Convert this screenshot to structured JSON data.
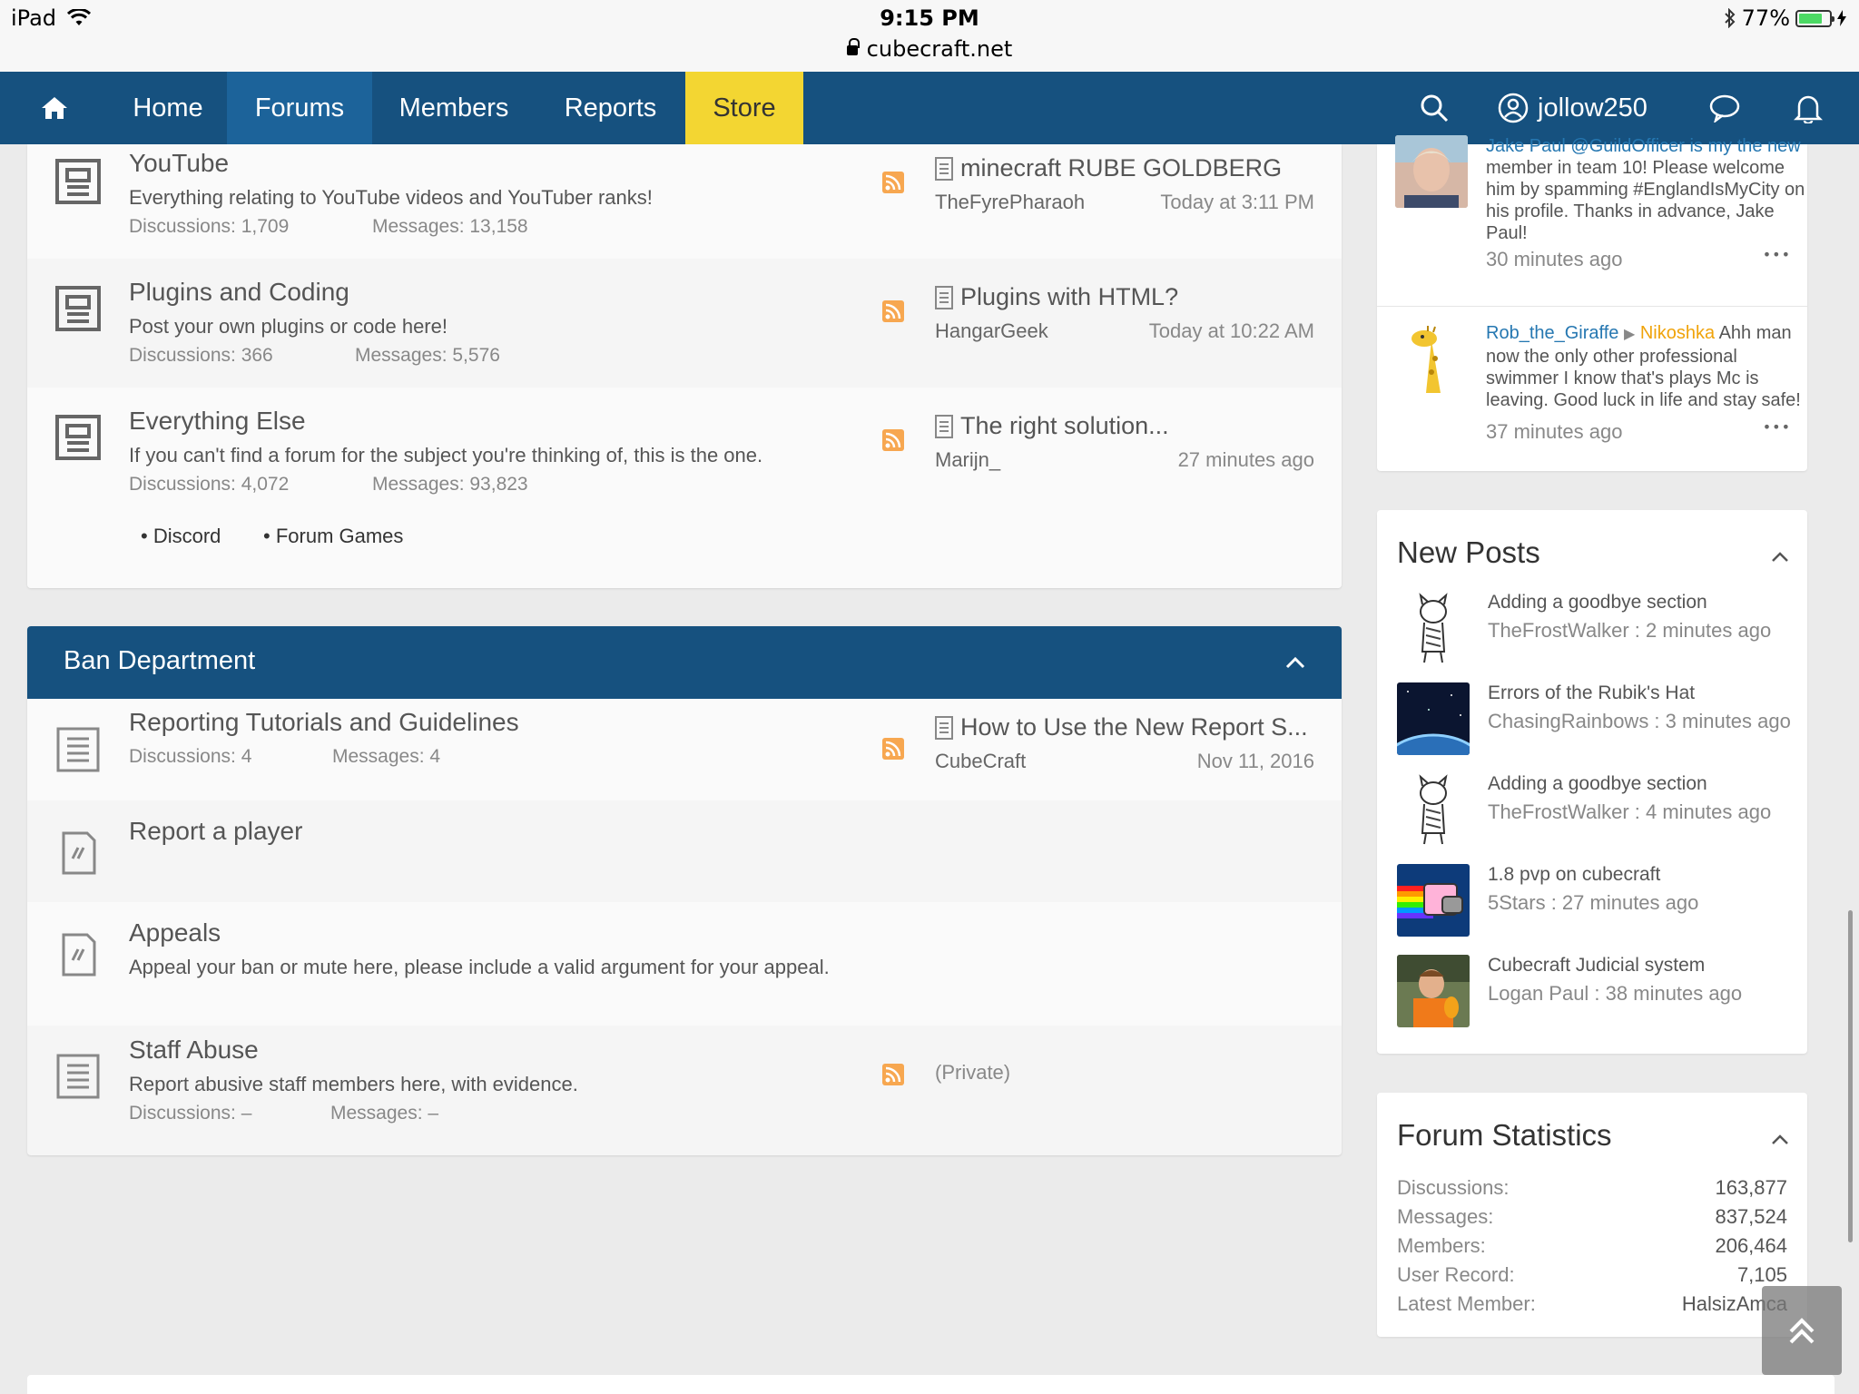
{
  "status_bar": {
    "device": "iPad",
    "time": "9:15 PM",
    "url": "cubecraft.net",
    "battery": "77%",
    "battery_level": 0.77
  },
  "nav": {
    "tabs": [
      "Home",
      "Forums",
      "Members",
      "Reports",
      "Store"
    ],
    "active_tab": "Forums",
    "username": "jollow250",
    "colors": {
      "bar": "#16517f",
      "active": "#1c639a",
      "store": "#f3d632"
    }
  },
  "forums_top": {
    "nodes": [
      {
        "title": "YouTube",
        "description": "Everything relating to YouTube videos and YouTuber ranks!",
        "discussions": "Discussions: 1,709",
        "messages": "Messages: 13,158",
        "last_thread": "minecraft RUBE GOLDBERG",
        "last_user": "TheFyrePharaoh",
        "last_date": "Today at 3:11 PM"
      },
      {
        "title": "Plugins and Coding",
        "description": "Post your own plugins or code here!",
        "discussions": "Discussions: 366",
        "messages": "Messages: 5,576",
        "last_thread": "Plugins with HTML?",
        "last_user": "HangarGeek",
        "last_date": "Today at 10:22 AM"
      },
      {
        "title": "Everything Else",
        "description": "If you can't find a forum for the subject you're thinking of, this is the one.",
        "discussions": "Discussions: 4,072",
        "messages": "Messages: 93,823",
        "last_thread": "The right solution...",
        "last_user": "Marijn_",
        "last_date": "27 minutes ago"
      }
    ],
    "subforums": [
      "Discord",
      "Forum Games"
    ]
  },
  "ban_department": {
    "title": "Ban Department",
    "nodes": [
      {
        "title": "Reporting Tutorials and Guidelines",
        "discussions": "Discussions: 4",
        "messages": "Messages: 4",
        "last_thread": "How to Use the New Report S...",
        "last_user": "CubeCraft",
        "last_date": "Nov 11, 2016"
      },
      {
        "title": "Report a player"
      },
      {
        "title": "Appeals",
        "description": "Appeal your ban or mute here, please include a valid argument for your appeal."
      },
      {
        "title": "Staff Abuse",
        "description": "Report abusive staff members here, with evidence.",
        "discussions": "Discussions: –",
        "messages": "Messages: –",
        "last_private": "(Private)"
      }
    ]
  },
  "profile_posts": [
    {
      "text_top": "Jake Paul @GuildOfficer is my the new",
      "text_rest": "member in team 10! Please welcome him by spamming #EnglandIsMyCity on his profile. Thanks in advance, Jake Paul!",
      "time": "30 minutes ago",
      "more": "•••"
    },
    {
      "author": "Rob_the_Giraffe",
      "arrow": "▶",
      "target": "Nikoshka",
      "text": "Ahh man now the only other professional swimmer I know that's plays Mc is leaving. Good luck in life and stay safe!",
      "time": "37 minutes ago",
      "more": "•••"
    }
  ],
  "new_posts": {
    "title": "New Posts",
    "items": [
      {
        "title": "Adding a goodbye section",
        "meta": "TheFrostWalker : 2 minutes ago",
        "thumb": "cat-sketch"
      },
      {
        "title": "Errors of the Rubik's Hat",
        "meta": "ChasingRainbows : 3 minutes ago",
        "thumb": "space-earth"
      },
      {
        "title": "Adding a goodbye section",
        "meta": "TheFrostWalker : 4 minutes ago",
        "thumb": "cat-sketch"
      },
      {
        "title": "1.8 pvp on cubecraft",
        "meta": "5Stars : 27 minutes ago",
        "thumb": "nyan-cat"
      },
      {
        "title": "Cubecraft Judicial system",
        "meta": "Logan Paul : 38 minutes ago",
        "thumb": "person-parrot"
      }
    ]
  },
  "forum_statistics": {
    "title": "Forum Statistics",
    "rows": [
      {
        "label": "Discussions:",
        "value": "163,877"
      },
      {
        "label": "Messages:",
        "value": "837,524"
      },
      {
        "label": "Members:",
        "value": "206,464"
      },
      {
        "label": "User Record:",
        "value": "7,105"
      },
      {
        "label": "Latest Member:",
        "value": "HalsizAmca"
      }
    ]
  }
}
